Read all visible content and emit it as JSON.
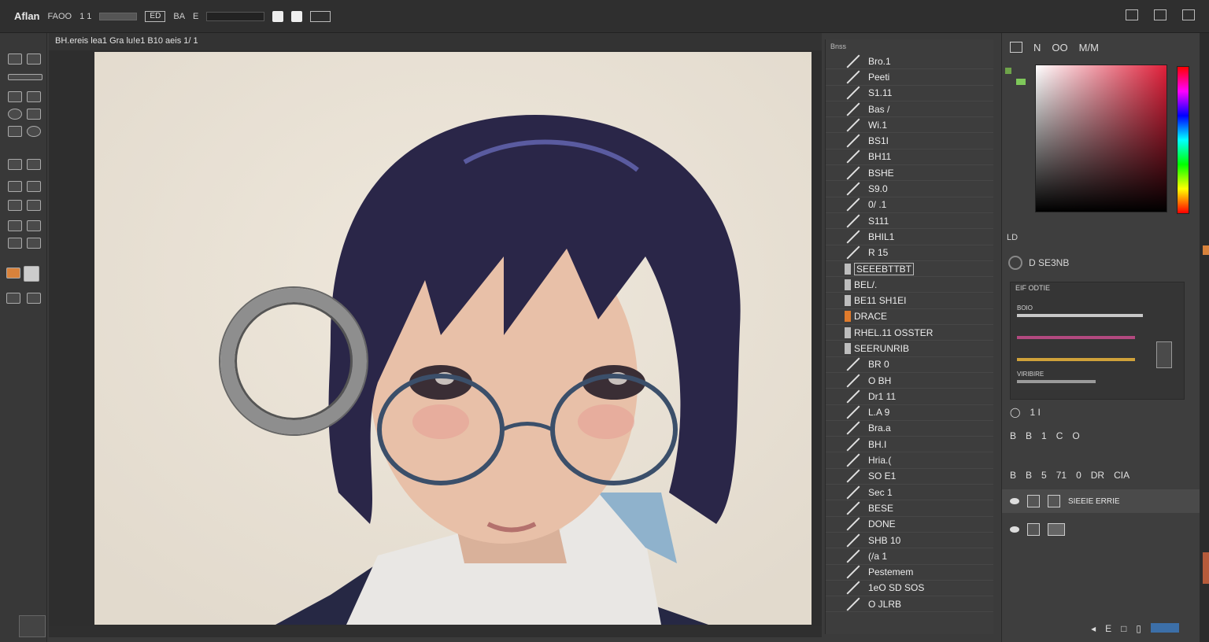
{
  "topbar": {
    "app_name": "Aflan",
    "options": [
      "FAOO",
      "1 1",
      "E",
      "BA"
    ],
    "box_label": "ED"
  },
  "document": {
    "tab_title": "BH.ereis lea1 Gra lu!e1 B10 aeis 1/ 1"
  },
  "brushes_panel": {
    "header": "Bnss",
    "items": [
      {
        "name": "Bro.1",
        "kind": "stroke"
      },
      {
        "name": "Peeti",
        "kind": "stroke"
      },
      {
        "name": "S1.11",
        "kind": "stroke"
      },
      {
        "name": "Bas /",
        "kind": "stroke"
      },
      {
        "name": "Wi.1",
        "kind": "stroke"
      },
      {
        "name": "BS1I",
        "kind": "stroke"
      },
      {
        "name": "BH11",
        "kind": "stroke"
      },
      {
        "name": "BSHE",
        "kind": "stroke"
      },
      {
        "name": "S9.0",
        "kind": "stroke"
      },
      {
        "name": "0/ .1",
        "kind": "stroke"
      },
      {
        "name": "S111",
        "kind": "stroke"
      },
      {
        "name": "BHIL1",
        "kind": "stroke"
      },
      {
        "name": "R 15",
        "kind": "stroke"
      },
      {
        "name": "SEEEBTTBT",
        "kind": "chip"
      },
      {
        "name": "BEL/.",
        "kind": "chip"
      },
      {
        "name": "BE11 SH1EI",
        "kind": "chip"
      },
      {
        "name": "DRACE",
        "kind": "chip-orange"
      },
      {
        "name": "RHEL.11 OSSTER",
        "kind": "chip"
      },
      {
        "name": "SEERUNRIB",
        "kind": "chip"
      },
      {
        "name": "BR 0",
        "kind": "stroke"
      },
      {
        "name": "O BH",
        "kind": "stroke"
      },
      {
        "name": "Dr1 11",
        "kind": "stroke"
      },
      {
        "name": "L.A 9",
        "kind": "stroke"
      },
      {
        "name": "Bra.a",
        "kind": "stroke"
      },
      {
        "name": "BH.I",
        "kind": "stroke"
      },
      {
        "name": "Hria.(",
        "kind": "stroke"
      },
      {
        "name": "SO E1",
        "kind": "stroke"
      },
      {
        "name": "Sec 1",
        "kind": "stroke"
      },
      {
        "name": "BESE",
        "kind": "stroke"
      },
      {
        "name": "DONE",
        "kind": "stroke"
      },
      {
        "name": "SHB 10",
        "kind": "stroke"
      },
      {
        "name": "(/a 1",
        "kind": "stroke"
      },
      {
        "name": "Pestemem",
        "kind": "stroke"
      },
      {
        "name": "1eO SD SOS",
        "kind": "stroke"
      },
      {
        "name": "O JLRB",
        "kind": "stroke"
      }
    ]
  },
  "color_panel": {
    "tabs": [
      "N",
      "OO",
      "M/M"
    ],
    "fg_color": "#6ea34a",
    "hue_color": "#e0203a"
  },
  "layers_panel": {
    "section_label": "LD",
    "header_label": "D SE3NB",
    "adjust_title": "EIF ODTIE",
    "adjust_rows": [
      {
        "label": "BOIO",
        "color": "#c8c8c8"
      },
      {
        "label": "",
        "color": "#b3497f"
      },
      {
        "label": "",
        "color": "#d0a23a"
      },
      {
        "label": "VIRIBIRE",
        "color": "#9a9a9a"
      }
    ],
    "options_row": "1 I",
    "tool_row": [
      "B",
      "B",
      "1",
      "C",
      "O"
    ],
    "blend_row": [
      "B",
      "B",
      "5",
      "71",
      "0",
      "DR",
      "CIA"
    ],
    "layers": [
      {
        "name": "SIEEIE ERRIE",
        "active": true
      },
      {
        "name": "",
        "active": false
      }
    ]
  }
}
